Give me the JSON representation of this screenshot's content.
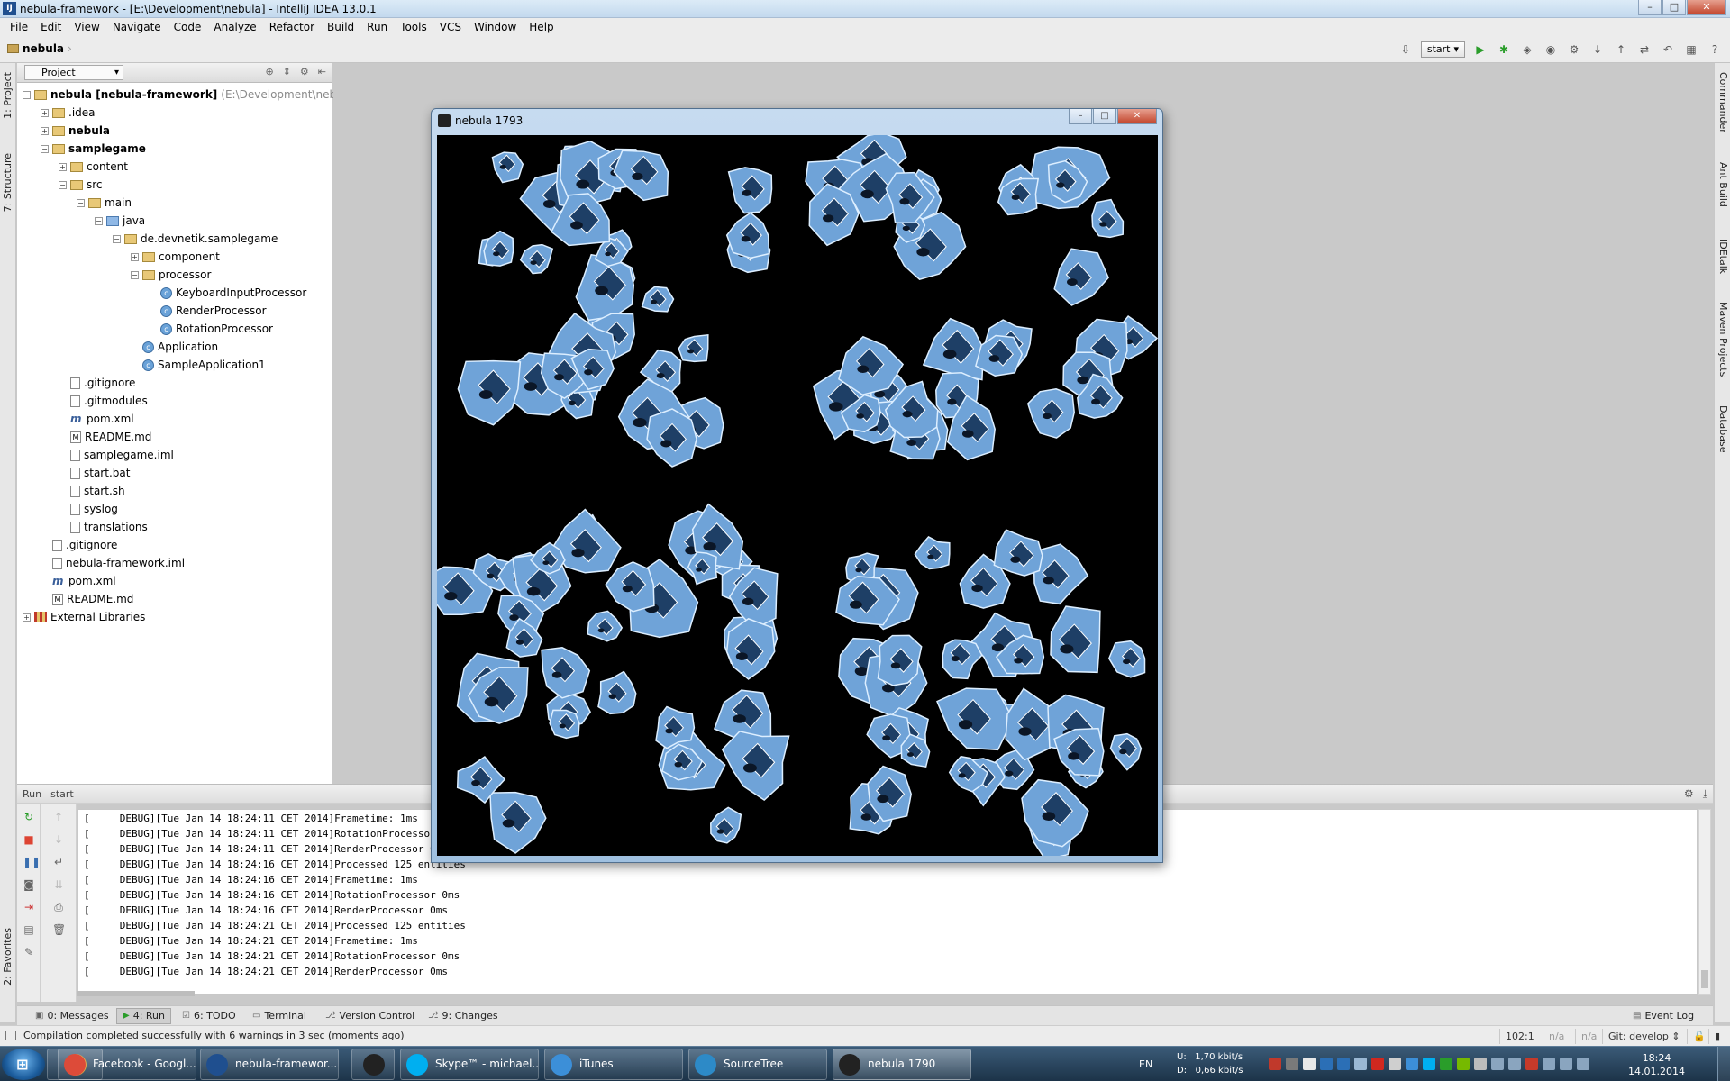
{
  "window": {
    "title": "nebula-framework - [E:\\Development\\nebula] - IntelliJ IDEA 13.0.1",
    "app_icon": "intellij-icon",
    "controls": [
      "minimize",
      "maximize",
      "close"
    ]
  },
  "menu": [
    "File",
    "Edit",
    "View",
    "Navigate",
    "Code",
    "Analyze",
    "Refactor",
    "Build",
    "Run",
    "Tools",
    "VCS",
    "Window",
    "Help"
  ],
  "navbar": {
    "breadcrumb": "nebula",
    "run_config": "start"
  },
  "left_strip": {
    "project_tab": "1: Project",
    "structure_tab": "7: Structure",
    "favorites_tab": "2: Favorites"
  },
  "right_strip": [
    "Commander",
    "Ant Build",
    "IDEtalk",
    "Maven Projects",
    "Database"
  ],
  "project_panel": {
    "view_selector": "Project",
    "tree": [
      {
        "label": "nebula [nebula-framework]",
        "extra": "(E:\\Development\\nebula)",
        "icon": "module-folder-icon",
        "bold": true
      },
      {
        "label": ".idea",
        "icon": "folder-icon"
      },
      {
        "label": "nebula",
        "icon": "module-folder-icon",
        "bold": true
      },
      {
        "label": "samplegame",
        "icon": "module-folder-icon",
        "bold": true
      },
      {
        "label": "content",
        "icon": "folder-icon"
      },
      {
        "label": "src",
        "icon": "folder-icon"
      },
      {
        "label": "main",
        "icon": "folder-icon"
      },
      {
        "label": "java",
        "icon": "source-folder-icon"
      },
      {
        "label": "de.devnetik.samplegame",
        "icon": "package-icon"
      },
      {
        "label": "component",
        "icon": "package-icon"
      },
      {
        "label": "processor",
        "icon": "package-icon"
      },
      {
        "label": "KeyboardInputProcessor",
        "icon": "class-icon"
      },
      {
        "label": "RenderProcessor",
        "icon": "class-icon"
      },
      {
        "label": "RotationProcessor",
        "icon": "class-icon"
      },
      {
        "label": "Application",
        "icon": "class-icon"
      },
      {
        "label": "SampleApplication1",
        "icon": "class-icon"
      },
      {
        "label": ".gitignore",
        "icon": "file-icon"
      },
      {
        "label": ".gitmodules",
        "icon": "file-icon"
      },
      {
        "label": "pom.xml",
        "icon": "maven-icon"
      },
      {
        "label": "README.md",
        "icon": "markdown-icon"
      },
      {
        "label": "samplegame.iml",
        "icon": "iml-icon"
      },
      {
        "label": "start.bat",
        "icon": "bat-icon"
      },
      {
        "label": "start.sh",
        "icon": "shell-icon"
      },
      {
        "label": "syslog",
        "icon": "file-icon"
      },
      {
        "label": "translations",
        "icon": "file-icon"
      },
      {
        "label": ".gitignore",
        "icon": "file-icon"
      },
      {
        "label": "nebula-framework.iml",
        "icon": "iml-icon"
      },
      {
        "label": "pom.xml",
        "icon": "maven-icon"
      },
      {
        "label": "README.md",
        "icon": "markdown-icon"
      },
      {
        "label": "External Libraries",
        "icon": "library-icon"
      }
    ]
  },
  "run_panel": {
    "title": "Run",
    "config": "start",
    "console_lines": [
      "[     DEBUG][Tue Jan 14 18:24:11 CET 2014]Frametime: 1ms",
      "[     DEBUG][Tue Jan 14 18:24:11 CET 2014]RotationProcessor 0ms",
      "[     DEBUG][Tue Jan 14 18:24:11 CET 2014]RenderProcessor 0ms",
      "[     DEBUG][Tue Jan 14 18:24:16 CET 2014]Processed 125 entities",
      "[     DEBUG][Tue Jan 14 18:24:16 CET 2014]Frametime: 1ms",
      "[     DEBUG][Tue Jan 14 18:24:16 CET 2014]RotationProcessor 0ms",
      "[     DEBUG][Tue Jan 14 18:24:16 CET 2014]RenderProcessor 0ms",
      "[     DEBUG][Tue Jan 14 18:24:21 CET 2014]Processed 125 entities",
      "[     DEBUG][Tue Jan 14 18:24:21 CET 2014]Frametime: 1ms",
      "[     DEBUG][Tue Jan 14 18:24:21 CET 2014]RotationProcessor 0ms",
      "[     DEBUG][Tue Jan 14 18:24:21 CET 2014]RenderProcessor 0ms"
    ]
  },
  "tool_tabs": {
    "messages": "0: Messages",
    "run": "4: Run",
    "todo": "6: TODO",
    "terminal": "Terminal",
    "vcs": "Version Control",
    "changes": "9: Changes",
    "event_log": "Event Log"
  },
  "status": {
    "message": "Compilation completed successfully with 6 warnings in 3 sec (moments ago)",
    "position": "102:1",
    "na1": "n/a",
    "na2": "n/a",
    "git": "Git: develop"
  },
  "nebula_window": {
    "title": "nebula 1793",
    "canvas_background": "#000000",
    "sprite_color": "#6fa3d8"
  },
  "taskbar": {
    "tasks": [
      {
        "label": "",
        "icon": "explorer-icon",
        "color": "#d9a53a"
      },
      {
        "label": "Facebook - Googl...",
        "icon": "chrome-icon",
        "color": "#dd4b39"
      },
      {
        "label": "nebula-framewor...",
        "icon": "intellij-icon",
        "color": "#1f4f8f"
      },
      {
        "label": "",
        "icon": "steam-icon",
        "color": "#222222"
      },
      {
        "label": "Skype™ - michael...",
        "icon": "skype-icon",
        "color": "#00aff0"
      },
      {
        "label": "iTunes",
        "icon": "itunes-icon",
        "color": "#3c8fd8"
      },
      {
        "label": "SourceTree",
        "icon": "sourcetree-icon",
        "color": "#2d8ac7"
      },
      {
        "label": "nebula 1790",
        "icon": "java-window-icon",
        "color": "#222222"
      }
    ],
    "language": "EN",
    "net_upload": "U:   1,70 kbit/s",
    "net_download": "D:   0,66 kbit/s",
    "time": "18:24",
    "date": "14.01.2014"
  }
}
